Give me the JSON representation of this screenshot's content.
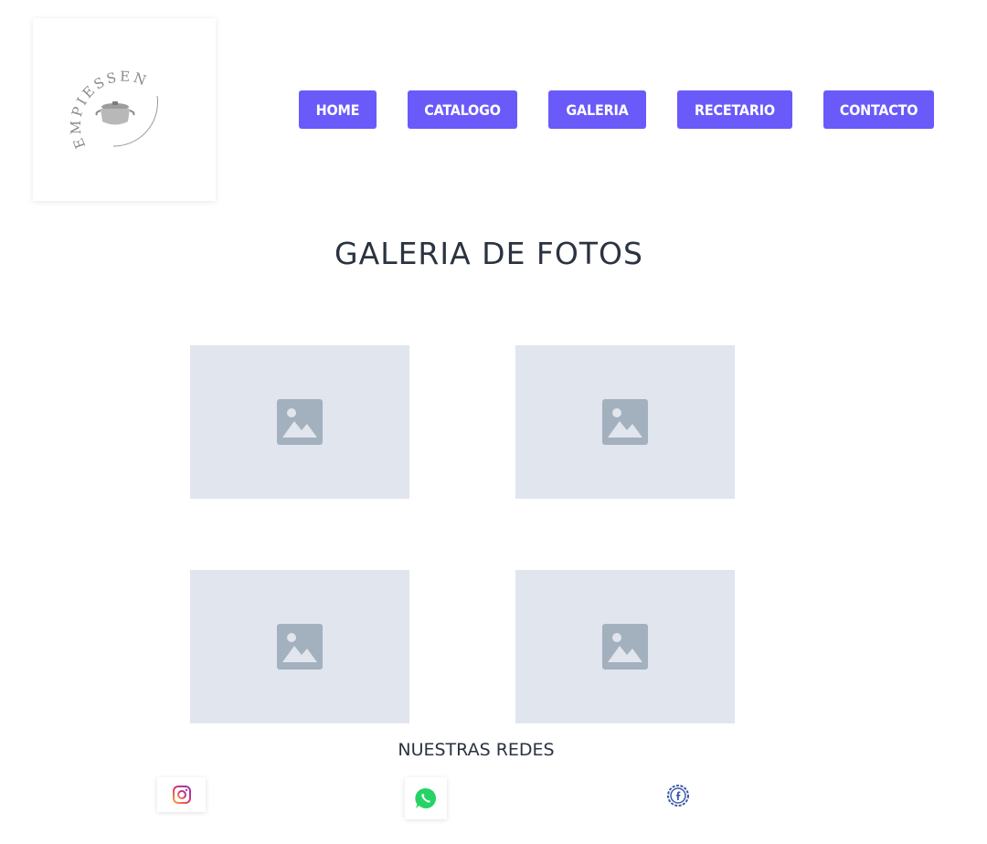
{
  "brand": {
    "logo_text": "EMPIESSEN",
    "logo_icon": "pot-icon"
  },
  "nav": {
    "items": [
      {
        "label": "HOME"
      },
      {
        "label": "CATALOGO"
      },
      {
        "label": "GALERIA"
      },
      {
        "label": "RECETARIO"
      },
      {
        "label": "CONTACTO"
      }
    ],
    "color": "#6a5af9"
  },
  "gallery": {
    "title": "GALERIA DE FOTOS",
    "photo_count": 4,
    "placeholder_icon": "image-placeholder-icon",
    "placeholder_bg": "#e0e5ee",
    "placeholder_icon_color": "#a3b0be"
  },
  "social": {
    "title": "NUESTRAS REDES",
    "links": [
      {
        "icon": "instagram-icon"
      },
      {
        "icon": "whatsapp-icon"
      },
      {
        "icon": "facebook-icon"
      }
    ]
  }
}
